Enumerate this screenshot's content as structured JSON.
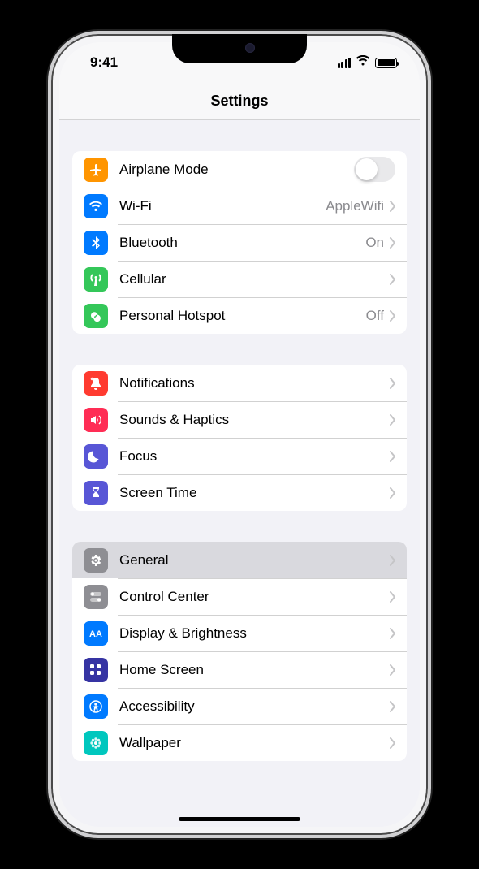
{
  "status": {
    "time": "9:41"
  },
  "header": {
    "title": "Settings"
  },
  "groups": [
    {
      "rows": [
        {
          "key": "airplane",
          "label": "Airplane Mode",
          "icon": "airplane",
          "color": "#ff9500",
          "control": "toggle",
          "toggle_on": false
        },
        {
          "key": "wifi",
          "label": "Wi-Fi",
          "icon": "wifi",
          "color": "#007aff",
          "detail": "AppleWifi",
          "control": "chevron"
        },
        {
          "key": "bluetooth",
          "label": "Bluetooth",
          "icon": "bluetooth",
          "color": "#007aff",
          "detail": "On",
          "control": "chevron"
        },
        {
          "key": "cellular",
          "label": "Cellular",
          "icon": "antenna",
          "color": "#34c759",
          "control": "chevron"
        },
        {
          "key": "hotspot",
          "label": "Personal Hotspot",
          "icon": "link",
          "color": "#34c759",
          "detail": "Off",
          "control": "chevron"
        }
      ]
    },
    {
      "rows": [
        {
          "key": "notifications",
          "label": "Notifications",
          "icon": "bell",
          "color": "#ff3b30",
          "control": "chevron"
        },
        {
          "key": "sounds",
          "label": "Sounds & Haptics",
          "icon": "speaker",
          "color": "#ff2d55",
          "control": "chevron"
        },
        {
          "key": "focus",
          "label": "Focus",
          "icon": "moon",
          "color": "#5856d6",
          "control": "chevron"
        },
        {
          "key": "screentime",
          "label": "Screen Time",
          "icon": "hourglass",
          "color": "#5856d6",
          "control": "chevron"
        }
      ]
    },
    {
      "rows": [
        {
          "key": "general",
          "label": "General",
          "icon": "gear",
          "color": "#8e8e93",
          "control": "chevron",
          "selected": true
        },
        {
          "key": "control",
          "label": "Control Center",
          "icon": "switches",
          "color": "#8e8e93",
          "control": "chevron"
        },
        {
          "key": "display",
          "label": "Display & Brightness",
          "icon": "aa",
          "color": "#007aff",
          "control": "chevron"
        },
        {
          "key": "homescreen",
          "label": "Home Screen",
          "icon": "grid",
          "color": "#3634a3",
          "control": "chevron"
        },
        {
          "key": "accessibility",
          "label": "Accessibility",
          "icon": "person",
          "color": "#007aff",
          "control": "chevron"
        },
        {
          "key": "wallpaper",
          "label": "Wallpaper",
          "icon": "flower",
          "color": "#00c7be",
          "control": "chevron"
        }
      ]
    }
  ]
}
